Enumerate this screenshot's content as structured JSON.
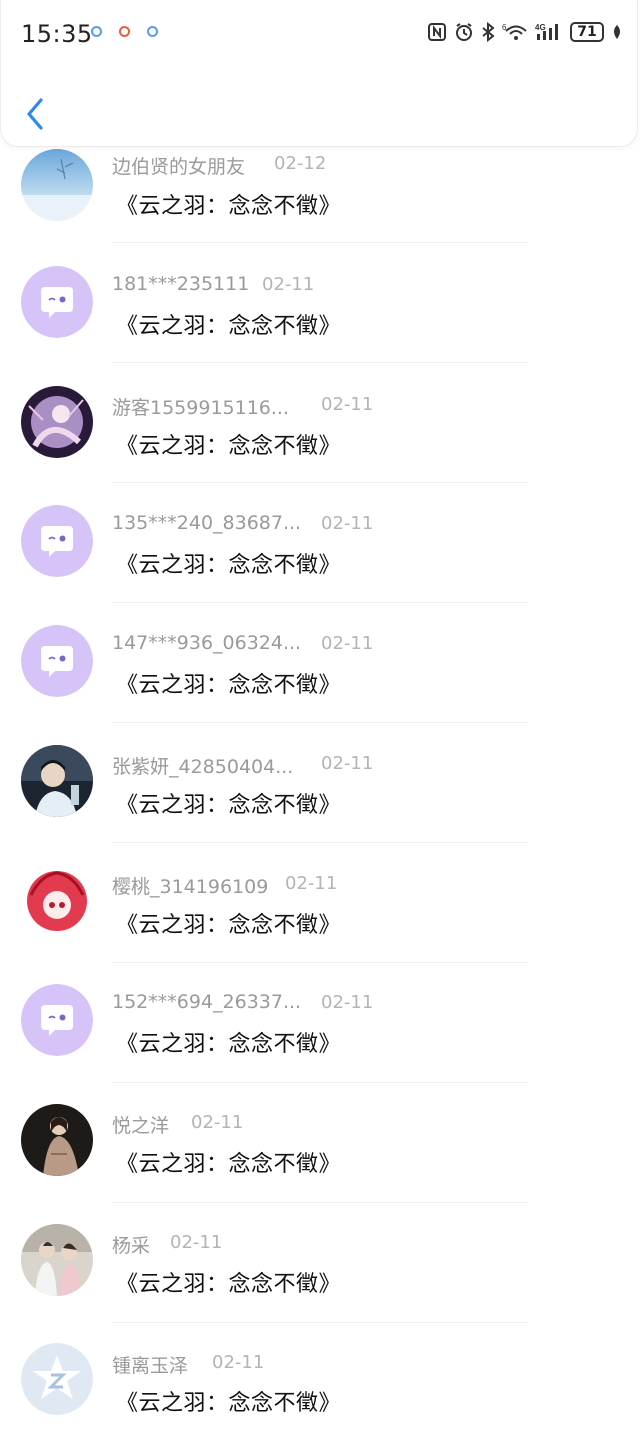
{
  "status_bar": {
    "time": "15:35",
    "battery": "71",
    "network": "4G",
    "icons": [
      "nfc-icon",
      "alarm-icon",
      "bluetooth-icon",
      "wifi-icon",
      "signal-icon",
      "battery-icon",
      "leaf-icon"
    ]
  },
  "header": {
    "back_icon": "chevron-left-icon"
  },
  "items": [
    {
      "name": "边伯贤的女朋友",
      "date": "02-12",
      "message": "《云之羽：念念不徵》",
      "avatar": "photo-winter"
    },
    {
      "name": "181***235111",
      "date": "02-11",
      "message": "《云之羽：念念不徵》",
      "avatar": "default-chat-bubble"
    },
    {
      "name": "游客1559915116...",
      "date": "02-11",
      "message": "《云之羽：念念不徵》",
      "avatar": "photo-anime-purple"
    },
    {
      "name": "135***240_83687...",
      "date": "02-11",
      "message": "《云之羽：念念不徵》",
      "avatar": "default-chat-bubble"
    },
    {
      "name": "147***936_06324...",
      "date": "02-11",
      "message": "《云之羽：念念不徵》",
      "avatar": "default-chat-bubble"
    },
    {
      "name": "张紫妍_42850404...",
      "date": "02-11",
      "message": "《云之羽：念念不徵》",
      "avatar": "photo-person-dark"
    },
    {
      "name": "樱桃_314196109",
      "date": "02-11",
      "message": "《云之羽：念念不徵》",
      "avatar": "drawing-red-girl"
    },
    {
      "name": "152***694_26337...",
      "date": "02-11",
      "message": "《云之羽：念念不徵》",
      "avatar": "default-chat-bubble"
    },
    {
      "name": "悦之洋",
      "date": "02-11",
      "message": "《云之羽：念念不徵》",
      "avatar": "photo-dress"
    },
    {
      "name": "杨采",
      "date": "02-11",
      "message": "《云之羽：念念不徵》",
      "avatar": "photo-couple"
    },
    {
      "name": "锺离玉泽",
      "date": "02-11",
      "message": "《云之羽：念念不徵》",
      "avatar": "default-star-logo"
    }
  ],
  "colors": {
    "default_avatar_bg": "#d6c3f7",
    "name_gray": "#9a9a9a",
    "date_gray": "#b4b4b4",
    "accent_blue": "#2b8be6"
  }
}
